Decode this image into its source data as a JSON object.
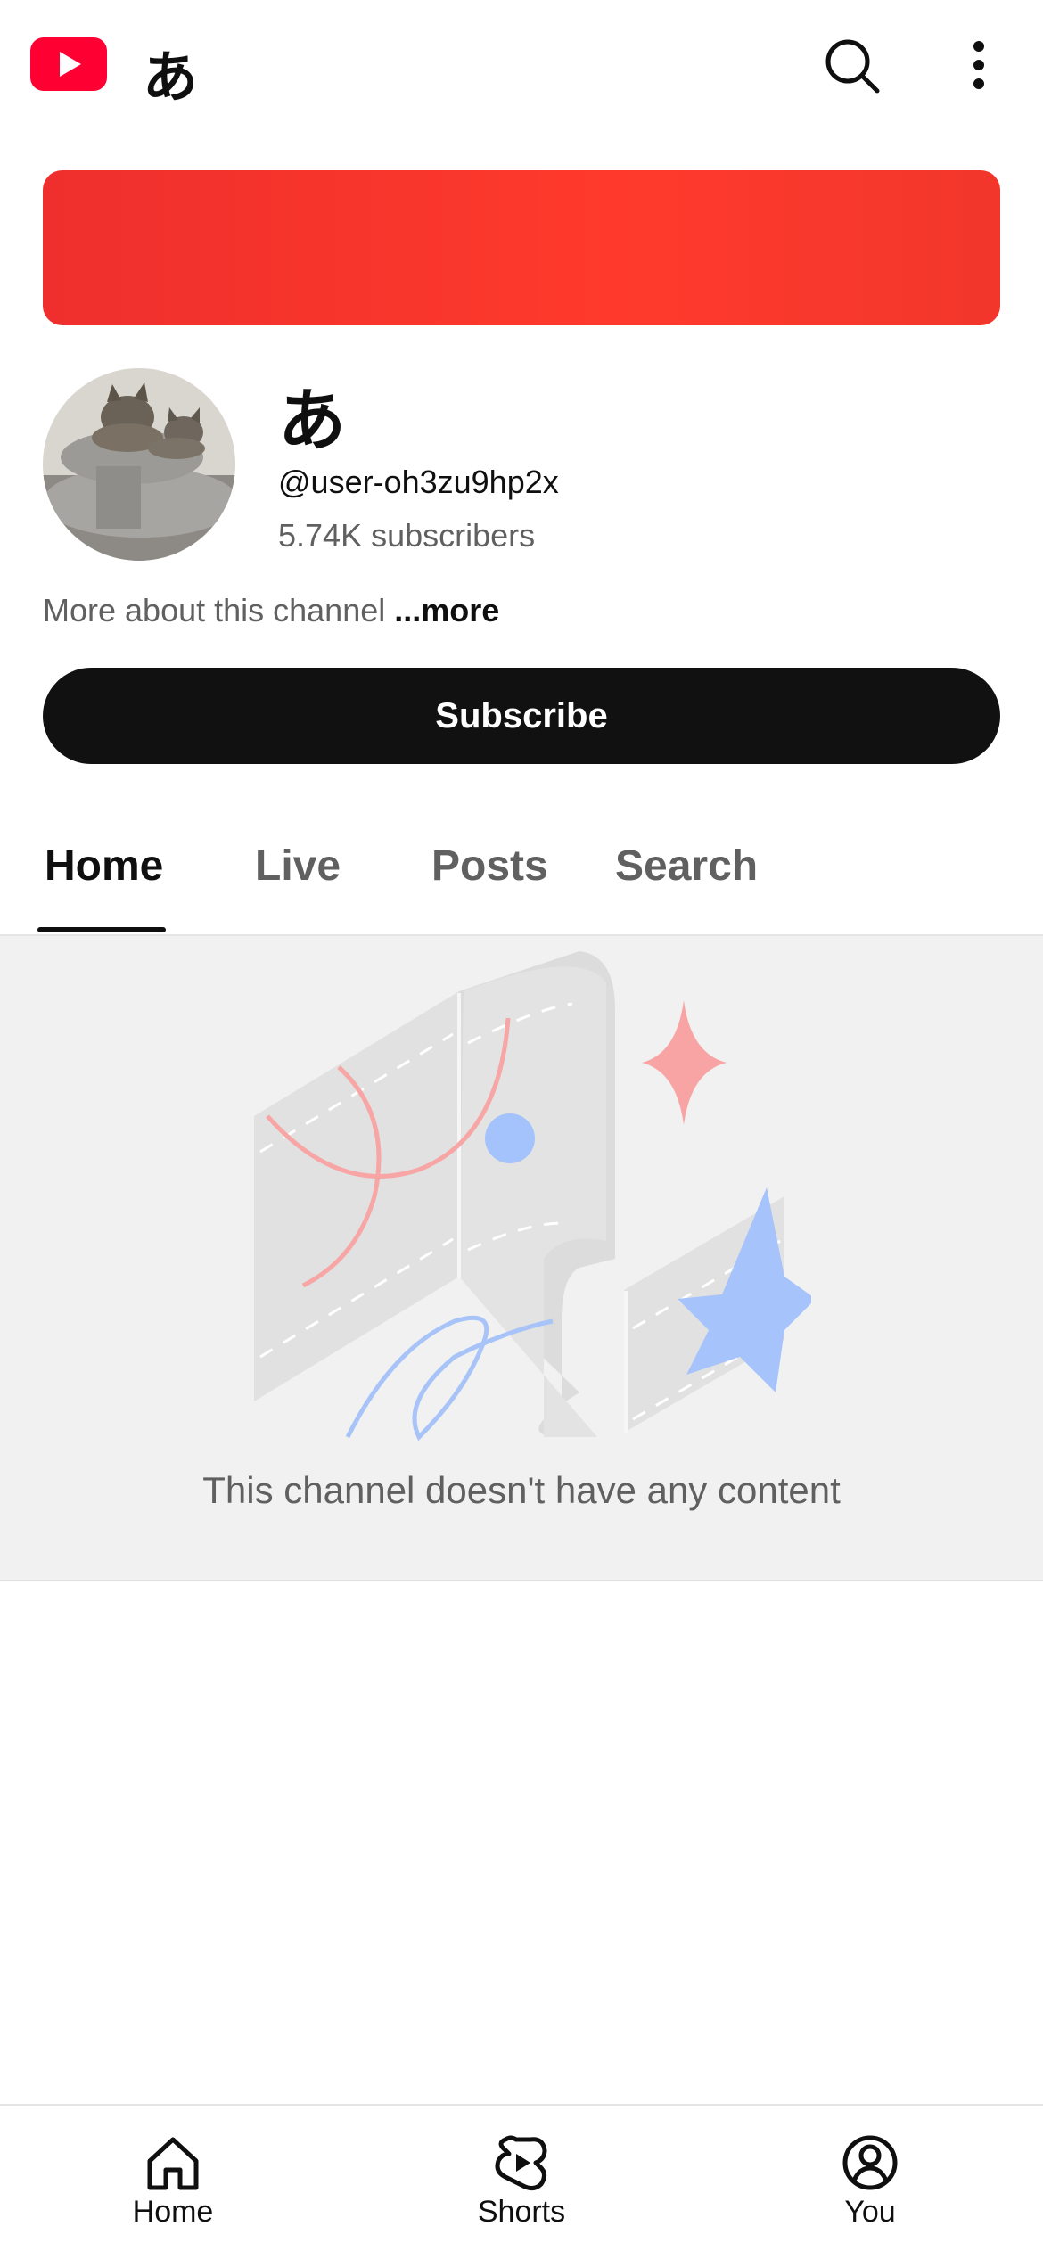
{
  "header": {
    "logo_icon": "youtube-logo-icon",
    "title": "あ",
    "icons": [
      "search-icon",
      "more-vert-icon"
    ]
  },
  "channel": {
    "name": "あ",
    "handle": "@user-oh3zu9hp2x",
    "subscribers": "5.74K subscribers",
    "about_text": "More about this channel",
    "about_more": "...more",
    "subscribe_label": "Subscribe",
    "banner_color": "#f5332a"
  },
  "tabs": [
    {
      "label": "Home",
      "active": true
    },
    {
      "label": "Live",
      "active": false
    },
    {
      "label": "Posts",
      "active": false
    },
    {
      "label": "Search",
      "active": false
    }
  ],
  "empty_state": {
    "message": "This channel doesn't have any content"
  },
  "bottom_nav": {
    "items": [
      {
        "label": "Home",
        "icon": "home-icon"
      },
      {
        "label": "Shorts",
        "icon": "shorts-icon"
      },
      {
        "label": "You",
        "icon": "account-icon"
      }
    ]
  },
  "colors": {
    "brand_red": "#ff0033",
    "button_dark": "#111111",
    "secondary_text": "#606060"
  }
}
